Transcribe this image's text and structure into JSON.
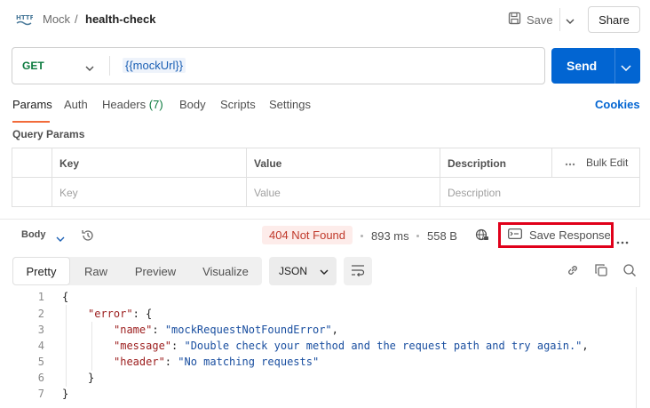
{
  "header": {
    "breadcrumb_parent": "Mock",
    "breadcrumb_sep": "/",
    "breadcrumb_current": "health-check",
    "save_label": "Save",
    "share_label": "Share"
  },
  "request": {
    "method": "GET",
    "url_variable": "{{mockUrl}}",
    "send_label": "Send"
  },
  "request_tabs": {
    "params": "Params",
    "auth": "Auth",
    "headers": "Headers",
    "headers_count": "(7)",
    "body": "Body",
    "scripts": "Scripts",
    "settings": "Settings",
    "cookies": "Cookies"
  },
  "query_params": {
    "title": "Query Params",
    "columns": [
      "Key",
      "Value",
      "Description"
    ],
    "bulk_edit": "Bulk Edit",
    "placeholders": [
      "Key",
      "Value",
      "Description"
    ]
  },
  "response": {
    "body_label": "Body",
    "status": "404 Not Found",
    "time": "893 ms",
    "size": "558 B",
    "save_response": "Save Response",
    "view_tabs": [
      "Pretty",
      "Raw",
      "Preview",
      "Visualize"
    ],
    "format": "JSON",
    "line_numbers": [
      "1",
      "2",
      "3",
      "4",
      "5",
      "6",
      "7"
    ],
    "json": {
      "key_error": "\"error\"",
      "key_name": "\"name\"",
      "val_name": "\"mockRequestNotFoundError\"",
      "key_message": "\"message\"",
      "val_message": "\"Double check your method and the request path and try again.\"",
      "key_header": "\"header\"",
      "val_header": "\"No matching requests\""
    }
  },
  "colors": {
    "accent": "#0265d2",
    "tab_underline": "#f26b3a",
    "method_green": "#0b7a3e",
    "status_red": "#c0392b",
    "highlight_box": "#e0001a"
  },
  "icons": [
    "http-icon",
    "save-icon",
    "chevron-down-icon",
    "history-icon",
    "globe-icon",
    "save-response-icon",
    "more-icon",
    "wrap-icon",
    "link-icon",
    "copy-icon",
    "search-icon"
  ]
}
